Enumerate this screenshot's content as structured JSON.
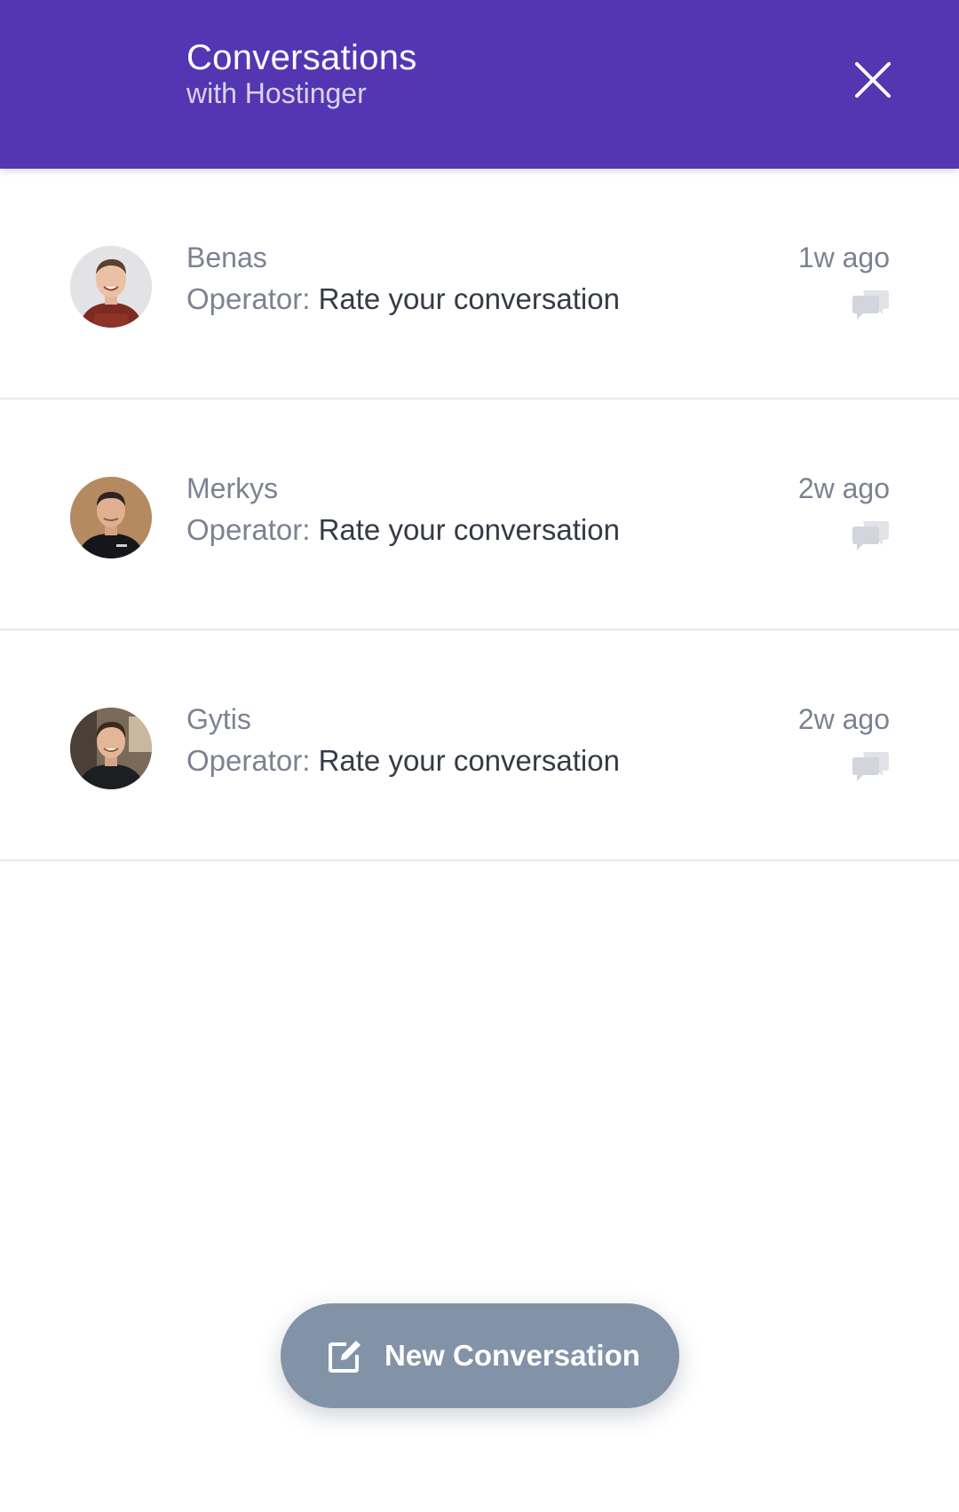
{
  "header": {
    "title": "Conversations",
    "subtitle": "with Hostinger",
    "close_icon": "close-icon"
  },
  "conversations": [
    {
      "name": "Benas",
      "prefix": "Operator:",
      "message": "Rate your conversation",
      "time": "1w ago",
      "icon": "chat-bubbles-icon"
    },
    {
      "name": "Merkys",
      "prefix": "Operator:",
      "message": "Rate your conversation",
      "time": "2w ago",
      "icon": "chat-bubbles-icon"
    },
    {
      "name": "Gytis",
      "prefix": "Operator:",
      "message": "Rate your conversation",
      "time": "2w ago",
      "icon": "chat-bubbles-icon"
    }
  ],
  "new_conversation": {
    "label": "New Conversation",
    "icon": "compose-icon"
  },
  "colors": {
    "header_bg": "#5436b3",
    "button_bg": "#8393a7",
    "muted_text": "#7c8291",
    "dark_text": "#353a46"
  }
}
